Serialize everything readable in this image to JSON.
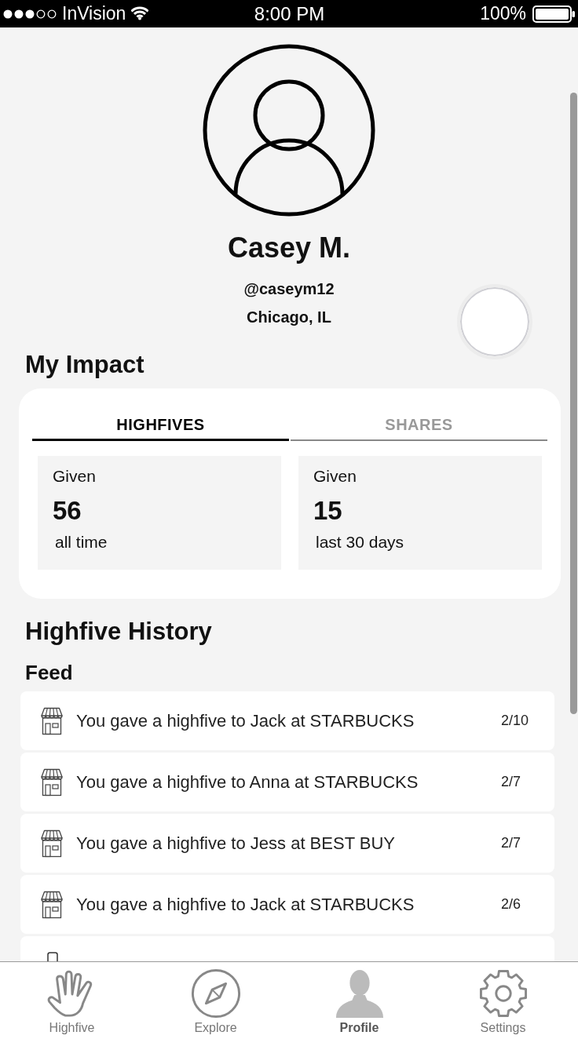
{
  "status_bar": {
    "carrier": "InVision",
    "time": "8:00 PM",
    "battery": "100%"
  },
  "profile": {
    "name": "Casey M.",
    "handle": "@caseym12",
    "location": "Chicago, IL"
  },
  "impact": {
    "title": "My Impact",
    "tabs": [
      {
        "label": "HIGHFIVES",
        "selected": true
      },
      {
        "label": "SHARES",
        "selected": false
      }
    ],
    "stats": [
      {
        "label": "Given",
        "value": "56",
        "period": "all time"
      },
      {
        "label": "Given",
        "value": "15",
        "period": "last 30 days"
      }
    ]
  },
  "history": {
    "title": "Highfive History",
    "subtitle": "Feed",
    "items": [
      {
        "kind": "store",
        "text": "You gave a highfive to Jack at STARBUCKS",
        "date": "2/10"
      },
      {
        "kind": "store",
        "text": "You gave a highfive to Anna at STARBUCKS",
        "date": "2/7"
      },
      {
        "kind": "store",
        "text": "You gave a highfive to Jess at BEST BUY",
        "date": "2/7"
      },
      {
        "kind": "store",
        "text": "You gave a highfive to Jack at STARBUCKS",
        "date": "2/6"
      },
      {
        "kind": "device"
      }
    ]
  },
  "tab_bar": [
    {
      "kind": "hand",
      "label": "Highfive",
      "selected": false
    },
    {
      "kind": "compass",
      "label": "Explore",
      "selected": false
    },
    {
      "kind": "person",
      "label": "Profile",
      "selected": true
    },
    {
      "kind": "gear",
      "label": "Settings",
      "selected": false
    }
  ]
}
